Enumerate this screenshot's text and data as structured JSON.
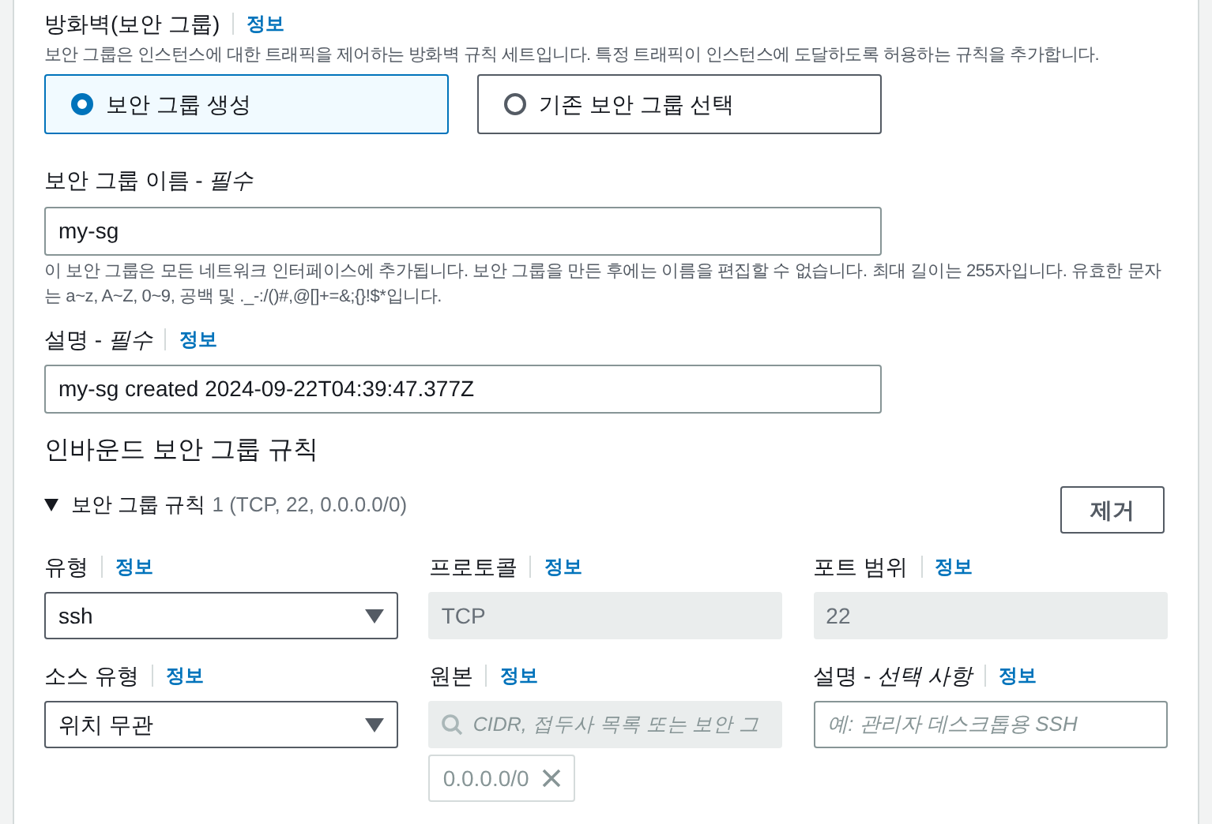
{
  "firewall": {
    "title": "방화벽(보안 그룹)",
    "info": "정보",
    "description": "보안 그룹은 인스턴스에 대한 트래픽을 제어하는 방화벽 규칙 세트입니다. 특정 트래픽이 인스턴스에 도달하도록 허용하는 규칙을 추가합니다.",
    "options": [
      {
        "label": "보안 그룹 생성",
        "selected": true
      },
      {
        "label": "기존 보안 그룹 선택",
        "selected": false
      }
    ]
  },
  "name_field": {
    "label": "보안 그룹 이름 - *필수*",
    "value": "my-sg",
    "help": "이 보안 그룹은 모든 네트워크 인터페이스에 추가됩니다. 보안 그룹을 만든 후에는 이름을 편집할 수 없습니다. 최대 길이는 255자입니다. 유효한 문자는 a~z, A~Z, 0~9, 공백 및 ._-:/()#,@[]+=&;{}!$*입니다."
  },
  "description_field": {
    "label": "설명 - *필수*",
    "info": "정보",
    "value": "my-sg created 2024-09-22T04:39:47.377Z"
  },
  "inbound": {
    "title": "인바운드 보안 그룹 규칙",
    "rules": [
      {
        "expanded": true,
        "title": "보안 그룹 규칙",
        "summary": "1 (TCP, 22, 0.0.0.0/0)",
        "remove": "제거",
        "fields": [
          {
            "kind": "select",
            "label": "유형",
            "info": "정보",
            "value": "ssh"
          },
          {
            "kind": "readonly",
            "label": "프로토콜",
            "info": "정보",
            "value": "TCP"
          },
          {
            "kind": "readonly",
            "label": "포트 범위",
            "info": "정보",
            "value": "22"
          },
          {
            "kind": "select",
            "label": "소스 유형",
            "info": "정보",
            "value": "위치 무관"
          },
          {
            "kind": "search",
            "label": "원본",
            "info": "정보",
            "placeholder": "CIDR, 접두사 목록 또는 보안 그",
            "tokens": [
              "0.0.0.0/0"
            ]
          },
          {
            "kind": "text",
            "label": "설명 - *선택 사항*",
            "info": "정보",
            "placeholder": "예: 관리자 데스크톱용 SSH"
          }
        ]
      }
    ]
  }
}
